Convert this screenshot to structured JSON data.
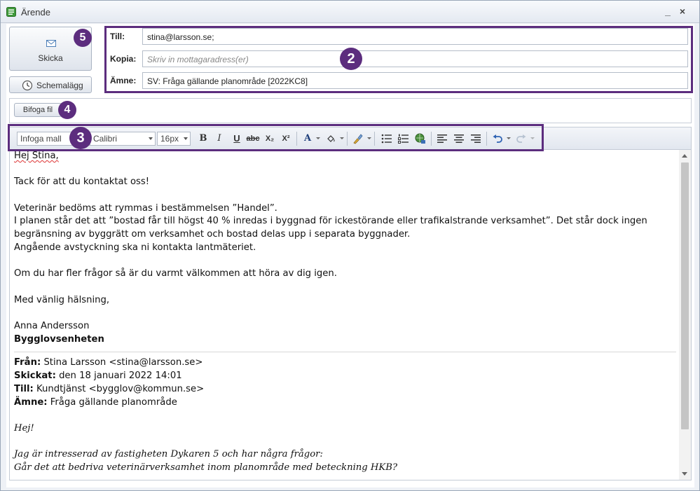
{
  "window": {
    "title": "Ärende",
    "minimize": "_",
    "close": "×"
  },
  "actions": {
    "send_label": "Skicka",
    "schedule_label": "Schemalägg",
    "attach_label": "Bifoga fil"
  },
  "fields": {
    "to": {
      "label": "Till:",
      "value": "stina@larsson.se;"
    },
    "cc": {
      "label": "Kopia:",
      "placeholder": "Skriv in mottagaradress(er)"
    },
    "subject": {
      "label": "Ämne:",
      "value": "SV: Fråga gällande planområde [2022KC8]"
    }
  },
  "toolbar": {
    "template": "Infoga mall",
    "font": "Calibri",
    "size": "16px",
    "bold": "B",
    "italic": "I",
    "underline": "U",
    "strike": "abc",
    "subscript": "X₂",
    "superscript": "X²",
    "font_color": "A"
  },
  "callouts": {
    "n2": "2",
    "n3": "3",
    "n4": "4",
    "n5": "5"
  },
  "accent_color": "#5c2d7e",
  "email": {
    "greeting": "Hej Stina,",
    "thanks": "Tack för att du kontaktat oss!",
    "p1": "Veterinär bedöms att rymmas i bestämmelsen ”Handel”.",
    "p2": "I planen står det att ”bostad får till högst 40 % inredas i byggnad för ickestörande eller trafikalstrande verksamhet”. Det står dock ingen begränsning av byggrätt om verksamhet och bostad delas upp i separata byggnader.",
    "p3": "Angående avstyckning ska ni kontakta lantmäteriet.",
    "p4": "Om du har fler frågor så är du varmt välkommen att höra av dig igen.",
    "closing": "Med vänlig hälsning,",
    "name": "Anna Andersson",
    "dept": "Bygglovsenheten",
    "from_label": "Från:",
    "from": "Stina Larsson <stina@larsson.se>",
    "sent_label": "Skickat:",
    "sent": "den 18 januari 2022 14:01",
    "to_label": "Till:",
    "to": "Kundtjänst <bygglov@kommun.se>",
    "subject_label": "Ämne:",
    "subject": "Fråga gällande planområde",
    "q_greeting": "Hej!",
    "q1": "Jag är intresserad av fastigheten Dykaren 5 och har några frågor:",
    "q2": "Går det att bedriva veterinärverksamhet inom planområde med beteckning HKB?"
  }
}
